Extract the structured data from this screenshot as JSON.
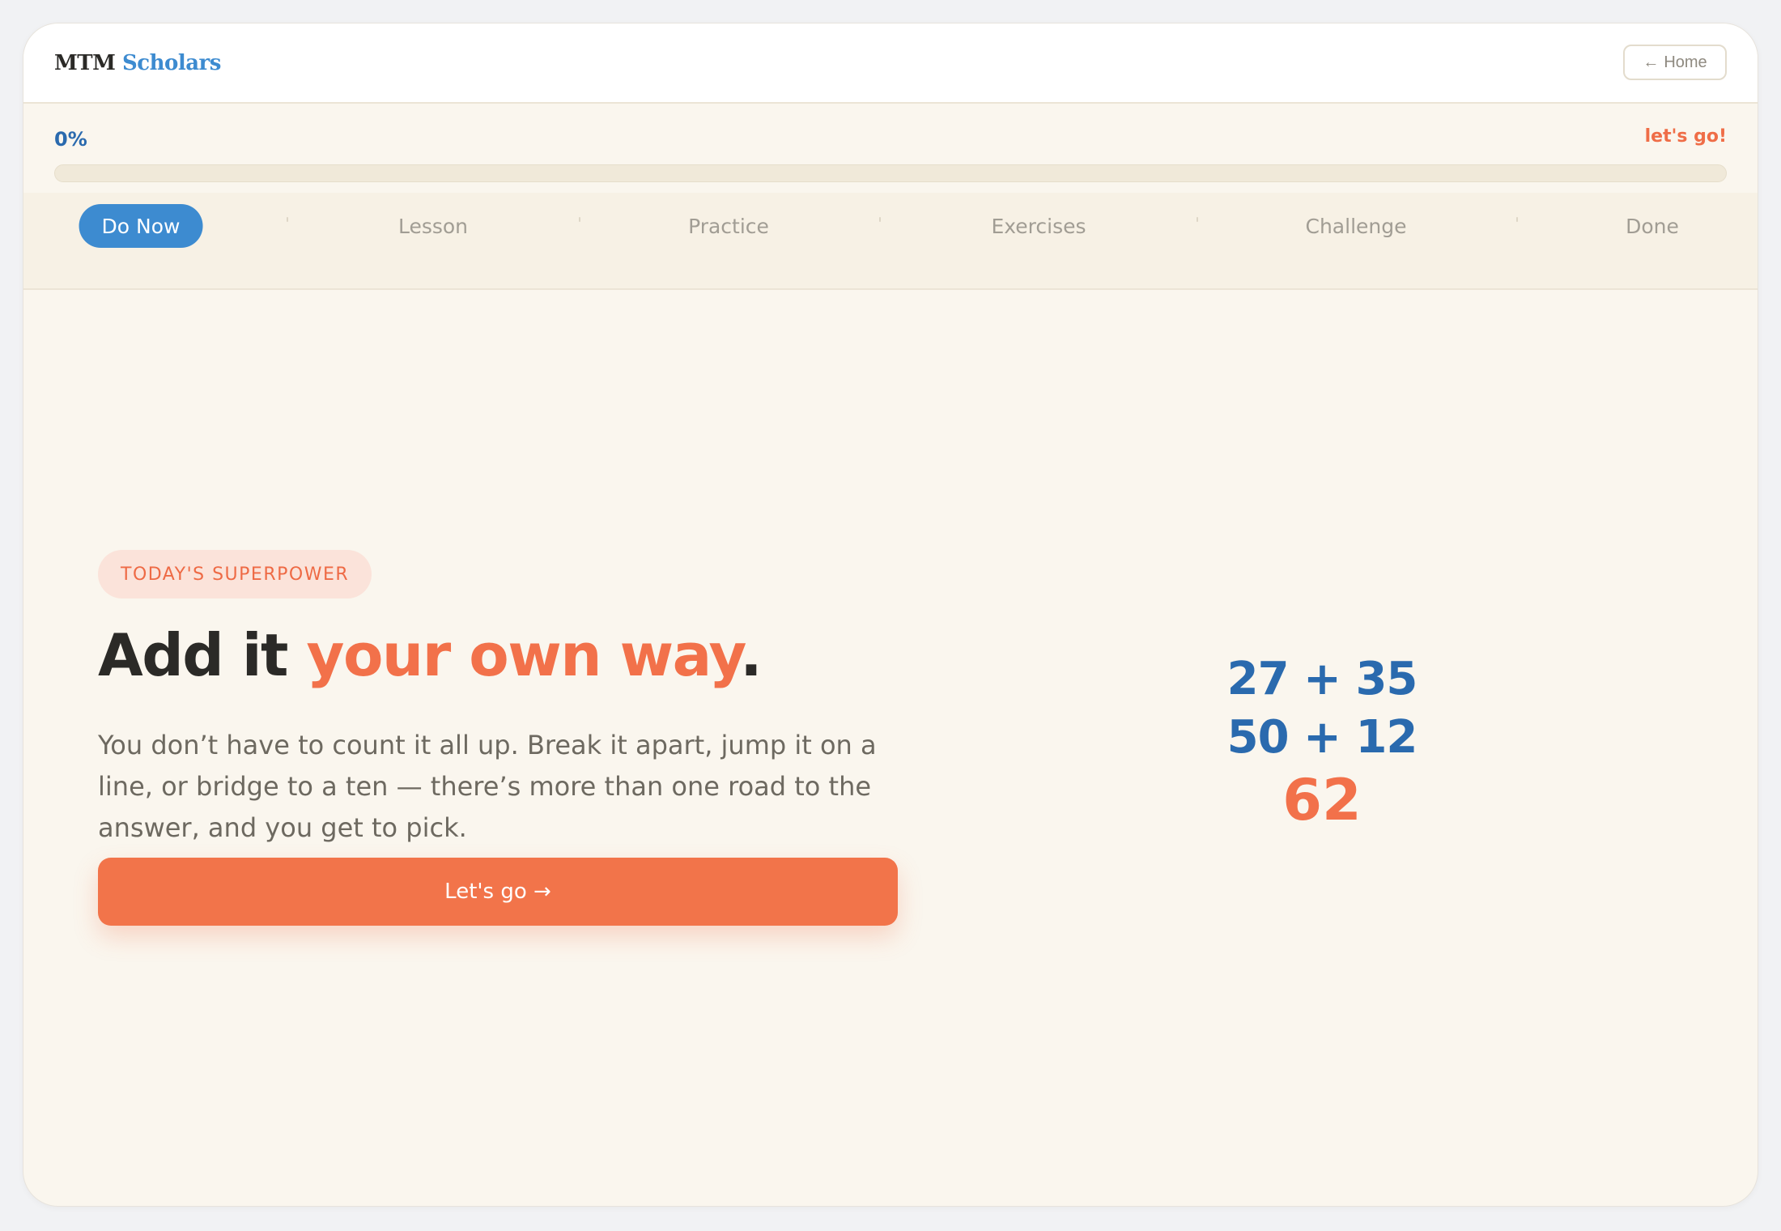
{
  "brand": {
    "part1": "MTM",
    "part2": "Scholars"
  },
  "header": {
    "home_arrow": "←",
    "home_label": "Home"
  },
  "progress": {
    "percent_label": "0%",
    "cheer": "let's go!",
    "value": 0
  },
  "steps": [
    {
      "label": "Do Now",
      "active": true
    },
    {
      "label": "Lesson",
      "active": false
    },
    {
      "label": "Practice",
      "active": false
    },
    {
      "label": "Exercises",
      "active": false
    },
    {
      "label": "Challenge",
      "active": false
    },
    {
      "label": "Done",
      "active": false
    }
  ],
  "hero": {
    "pill": "TODAY'S SUPERPOWER",
    "headline_start": "Add it ",
    "headline_accent": "your own way",
    "headline_end": ".",
    "body": "You don’t have to count it all up. Break it apart, jump it on a line, or bridge to a ten — there’s more than one road to the answer, and you get to pick.",
    "cta": "Let's go →"
  },
  "math": {
    "line1": "27 + 35",
    "line2": "50 + 12",
    "answer": "62"
  },
  "colors": {
    "blue": "#3d8bd0",
    "deep_blue": "#2a6aae",
    "orange": "#f2744a",
    "cream": "#faf6ee"
  }
}
